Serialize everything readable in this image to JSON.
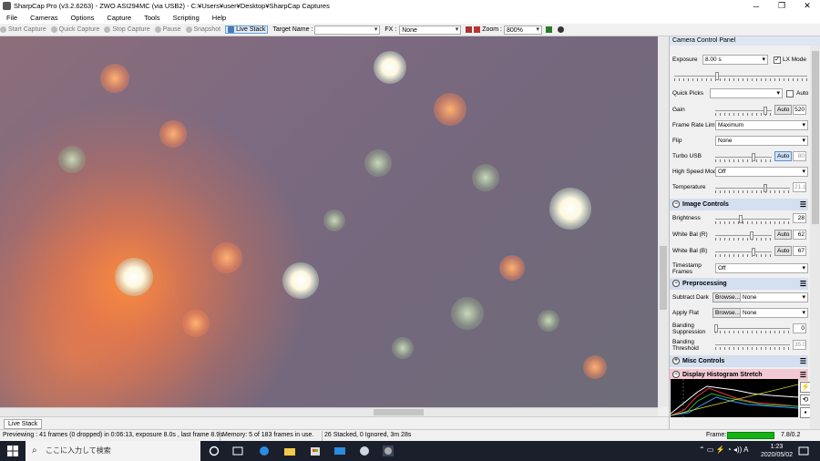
{
  "window": {
    "title": "SharpCap Pro (v3.2.6263) - ZWO ASI294MC (via USB2) - C:¥Users¥user¥Desktop¥SharpCap Captures",
    "minimize": "─",
    "maximize": "❐",
    "close": "✕"
  },
  "menu": [
    "File",
    "Cameras",
    "Options",
    "Capture",
    "Tools",
    "Scripting",
    "Help"
  ],
  "toolbar": {
    "start_capture": "Start Capture",
    "quick_capture": "Quick Capture",
    "stop_capture": "Stop Capture",
    "pause": "Pause",
    "snapshot": "Snapshot",
    "live_stack": "Live Stack",
    "target_name_label": "Target Name :",
    "fx_label": "FX :",
    "fx_value": "None",
    "zoom_label": "Zoom :",
    "zoom_value": "800%"
  },
  "panel": {
    "title": "Camera Control Panel",
    "exposure_label": "Exposure",
    "exposure_value": "8.00 s",
    "lx_mode_label": "LX Mode",
    "lx_mode_checked": "✓",
    "quick_picks_label": "Quick Picks",
    "auto_label": "Auto",
    "gain_label": "Gain",
    "gain_auto": "Auto",
    "gain_value": "520",
    "frame_rate_label": "Frame Rate Limit",
    "frame_rate_value": "Maximum",
    "flip_label": "Flip",
    "flip_value": "None",
    "turbo_usb_label": "Turbo USB",
    "turbo_usb_auto": "Auto",
    "turbo_usb_value": "80",
    "high_speed_label": "High Speed Mode",
    "high_speed_value": "Off",
    "temperature_label": "Temperature",
    "temperature_value": "21.1",
    "image_controls": "Image Controls",
    "brightness_label": "Brightness",
    "brightness_value": "28",
    "wb_r_label": "White Bal (R)",
    "wb_r_auto": "Auto",
    "wb_r_value": "62",
    "wb_b_label": "White Bal (B)",
    "wb_b_auto": "Auto",
    "wb_b_value": "67",
    "timestamp_label_1": "Timestamp",
    "timestamp_label_2": "Frames",
    "timestamp_value": "Off",
    "preprocessing": "Preprocessing",
    "subtract_dark_label": "Subtract Dark",
    "subtract_dark_browse": "Browse...",
    "subtract_dark_value": "None",
    "apply_flat_label": "Apply Flat",
    "apply_flat_browse": "Browse...",
    "apply_flat_value": "None",
    "banding_supp_1": "Banding",
    "banding_supp_2": "Suppression",
    "banding_supp_value": "0",
    "banding_thresh_1": "Banding",
    "banding_thresh_2": "Threshold",
    "banding_thresh_value": "35.0",
    "misc_controls": "Misc Controls",
    "histogram_stretch": "Display Histogram Stretch"
  },
  "tab": {
    "live_stack": "Live Stack"
  },
  "status": {
    "previewing": "Previewing : 41 frames (0 dropped) in 0:06:13, exposure 8.0s , last frame 8.9s",
    "memory": "Memory: 5 of 183 frames in use.",
    "stacked": "26 Stacked, 0 Ignored, 3m 28s",
    "frame_label": "Frame:",
    "frame_value": "7.8/0.2"
  },
  "taskbar": {
    "search_placeholder": "ここに入力して検索",
    "time": "1:23",
    "date": "2020/05/02"
  },
  "colors": {
    "accent": "#0078d7",
    "frame_bar": "#16b316",
    "section_header": "#d4dff0",
    "histogram_header": "#f2c8d4"
  }
}
